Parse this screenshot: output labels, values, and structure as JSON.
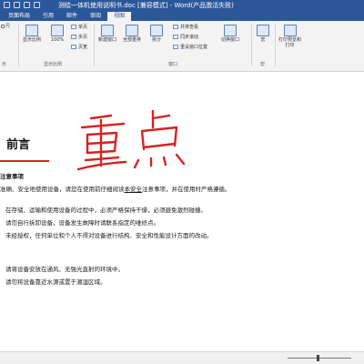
{
  "window": {
    "title": "测绘一体机使用说明书.doc [兼容模式] - Word(产品激活失败)"
  },
  "tabs": [
    {
      "label": "页面布局"
    },
    {
      "label": "引用"
    },
    {
      "label": "邮件"
    },
    {
      "label": "审阅"
    },
    {
      "label": "视图"
    }
  ],
  "ribbon": {
    "show_label": "显示比例",
    "zoom_label": "100%",
    "one_page": "单页",
    "multi_page": "多页",
    "page_width": "页宽",
    "new_window": "新建窗口",
    "arrange_all": "全部重排",
    "split": "拆分",
    "side_by_side": "并排查看",
    "sync_scroll": "同步滚动",
    "reset_window": "重设窗口位置",
    "switch_window": "切换窗口",
    "macro": "宏",
    "print_preview": "打印预览和",
    "print_preview_2": "打印",
    "group_zoom": "显示比例",
    "group_window": "窗口",
    "group_macro": "宏",
    "group_show": "示",
    "left_partial": "尺"
  },
  "document": {
    "heading": "前言",
    "handwriting": "重点",
    "lines": [
      "注意事项",
      "准确、安全地使用设备，请您在使用前仔细阅读本安全注意事项，并在使用时严格遵循。",
      "",
      "在存储、运输和使用设备的过程中，必须严格保持干燥，必须避免激烈碰撞。",
      "请勿自行拆卸设备，设备发生故障时请联系指定的维修点。",
      "未经授权，任何单位和个人不得对设备进行结构、安全和性能设计方面的改动。",
      "",
      "请将设备安放在通风、无强光直射的环境中。",
      "请勿将设备靠近水源或置于潮湿区域。"
    ],
    "underlined_phrase": "本安全"
  },
  "colors": {
    "title_bar": "#2b579a",
    "ink": "#d62222"
  }
}
